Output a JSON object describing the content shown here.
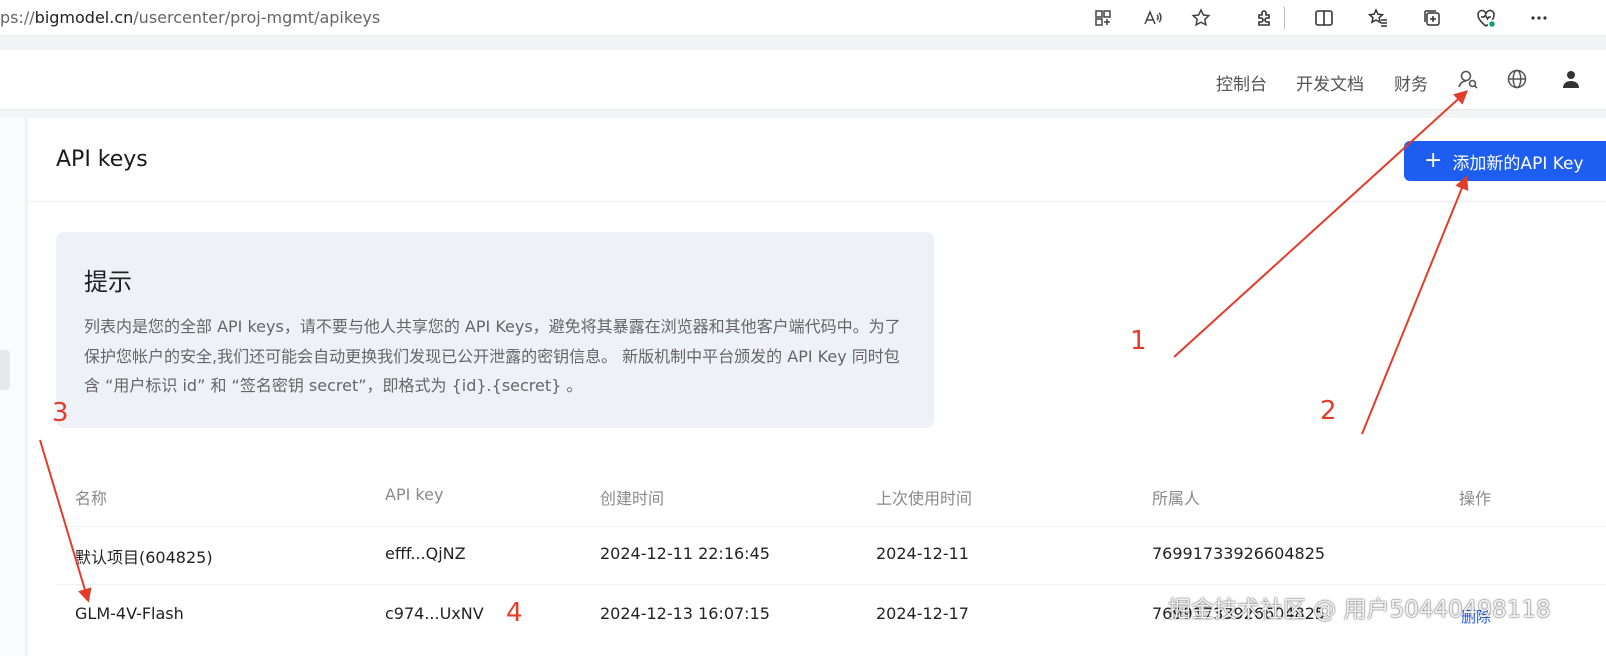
{
  "browser": {
    "url_prefix": "ps://",
    "url_host": "bigmodel.cn",
    "url_path": "/usercenter/proj-mgmt/apikeys",
    "icons": [
      "app-grid-icon",
      "read-aloud-icon",
      "favorite-star-icon",
      "extensions-icon",
      "split-screen-icon",
      "favorites-icon",
      "collections-icon",
      "browser-essentials-icon",
      "more-icon"
    ]
  },
  "header": {
    "nav": [
      "控制台",
      "开发文档",
      "财务"
    ],
    "icons": [
      "search-user-icon",
      "globe-icon",
      "user-icon"
    ]
  },
  "page": {
    "title": "API keys",
    "add_button": "添加新的API Key"
  },
  "tip": {
    "title": "提示",
    "body": "列表内是您的全部 API keys，请不要与他人共享您的 API Keys，避免将其暴露在浏览器和其他客户端代码中。为了保护您帐户的安全,我们还可能会自动更换我们发现已公开泄露的密钥信息。 新版机制中平台颁发的 API Key 同时包含 “用户标识 id” 和 “签名密钥 secret”，即格式为 {id}.{secret} 。"
  },
  "table": {
    "columns": [
      "名称",
      "API key",
      "创建时间",
      "上次使用时间",
      "所属人",
      "操作"
    ],
    "rows": [
      {
        "name": "默认项目(604825)",
        "key": "efff...QjNZ",
        "created": "2024-12-11 22:16:45",
        "last_used": "2024-12-11",
        "owner": "76991733926604825",
        "action": ""
      },
      {
        "name": "GLM-4V-Flash",
        "key": "c974...UxNV",
        "created": "2024-12-13 16:07:15",
        "last_used": "2024-12-17",
        "owner": "76991733926604825",
        "action": "删除"
      }
    ]
  },
  "annotations": {
    "n1": "1",
    "n2": "2",
    "n3": "3",
    "n4": "4",
    "color": "#e23d2a"
  },
  "watermark": "掘金技术社区 @ 用户50440498118",
  "colors": {
    "accent": "#1d5ef0",
    "tip_bg": "#eef1f7"
  }
}
